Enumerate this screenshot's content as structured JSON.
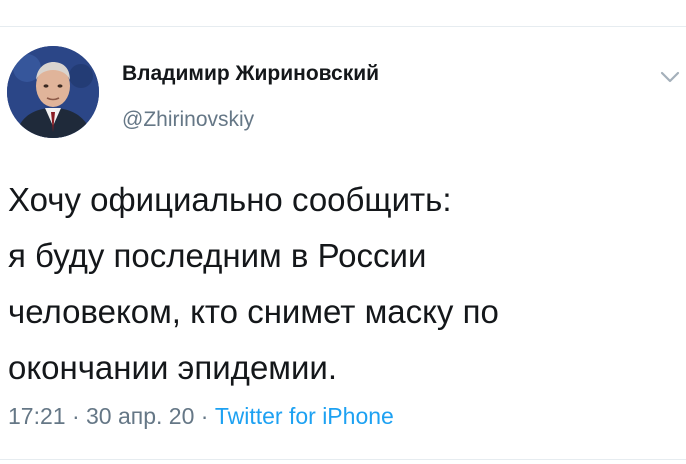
{
  "tweet": {
    "author": {
      "display_name": "Владимир Жириновский",
      "handle": "@Zhirinovskiy",
      "avatar_icon": "profile-photo"
    },
    "menu_icon": "chevron-down-icon",
    "text_lines": [
      "Хочу официально сообщить:",
      "я буду последним в России",
      "человеком, кто снимет маску по",
      "окончании эпидемии."
    ],
    "meta": {
      "time": "17:21",
      "separator_1": " · ",
      "date": "30 апр. 20",
      "separator_2": " · ",
      "source": "Twitter for iPhone"
    }
  },
  "colors": {
    "text": "#14171a",
    "secondary": "#657786",
    "link": "#1da1f2",
    "divider": "#e6ecf0"
  }
}
